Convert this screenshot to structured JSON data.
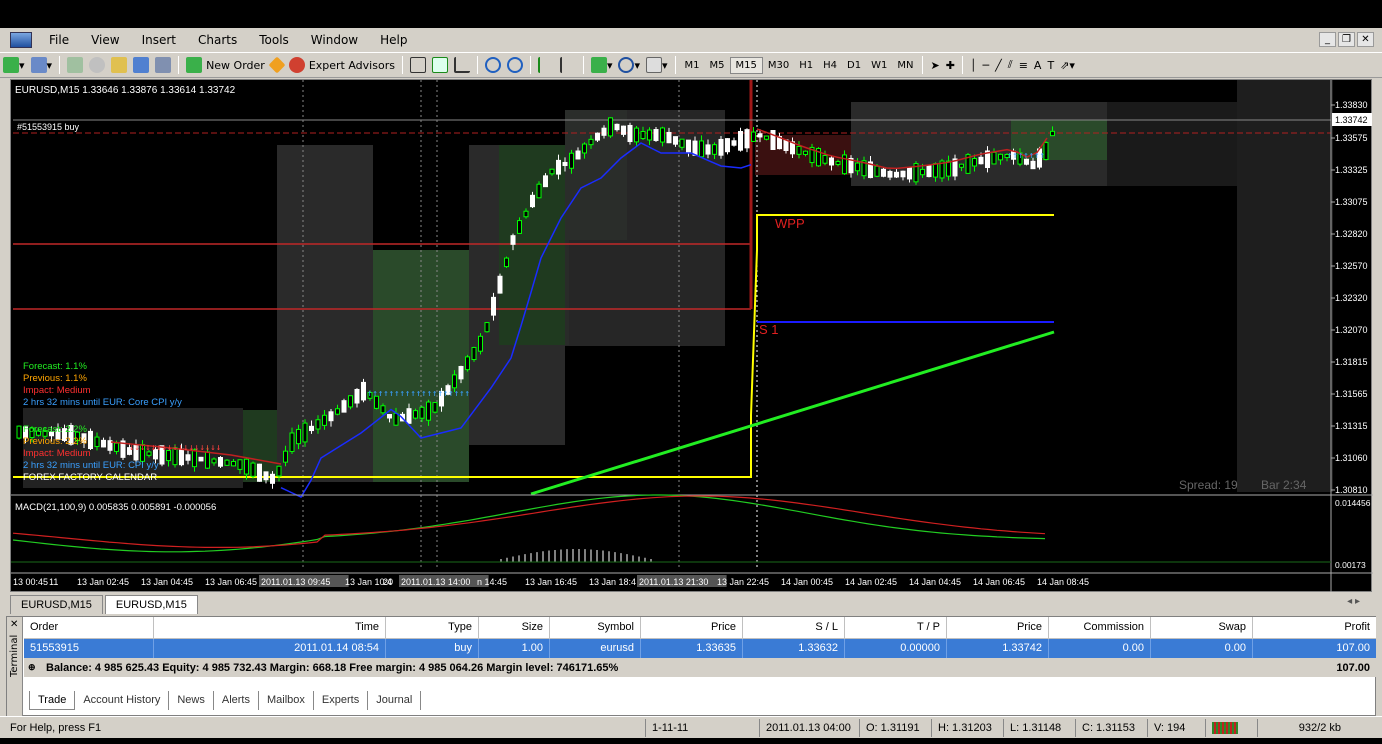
{
  "menu": {
    "items": [
      "File",
      "View",
      "Insert",
      "Charts",
      "Tools",
      "Window",
      "Help"
    ]
  },
  "toolbar": {
    "new_order": "New Order",
    "expert_advisors": "Expert Advisors",
    "timeframes": [
      "M1",
      "M5",
      "M15",
      "M30",
      "H1",
      "H4",
      "D1",
      "W1",
      "MN"
    ],
    "active_timeframe": "M15"
  },
  "chart": {
    "header": "EURUSD,M15  1.33646 1.33876 1.33614 1.33742",
    "order_line": "#51553915 buy",
    "wpp": "WPP",
    "s1": "S 1",
    "news1": {
      "forecast": "Forecast: 1.1%",
      "previous": "Previous: 1.1%",
      "impact": "Impact: Medium",
      "until": "2 hrs 32 mins until EUR: Core CPI y/y"
    },
    "news2": {
      "forecast": "Forecast: 2.2%",
      "previous": "Previous: 2.2%",
      "impact": "Impact: Medium",
      "until": "2 hrs 32 mins until EUR: CPI y/y",
      "calendar": "FOREX FACTORY CALENDAR"
    },
    "spread": "Spread: 19",
    "bar": "Bar  2:34",
    "macd_label": "MACD(21,100,9) 0.005835 0.005891 -0.000056",
    "price_labels": [
      "1.33830",
      "1.33742",
      "1.33575",
      "1.33325",
      "1.33075",
      "1.32820",
      "1.32570",
      "1.32320",
      "1.32070",
      "1.31815",
      "1.31565",
      "1.31315",
      "1.31060",
      "1.30810"
    ],
    "current_price": "1.33742",
    "macd_scale": [
      "0.014456",
      "0.00173"
    ],
    "time_labels": [
      "13 00:45",
      "11",
      "13 Jan 02:45",
      "13 Jan 04:45",
      "13 Jan 06:45",
      "2011.01.13 09:45",
      "13 Jan 10:4",
      "20",
      "2011.01.13 14:00",
      "n 14:45",
      "13 Jan 16:45",
      "13 Jan 18:4",
      "2011.01.13 21:30",
      "13 Jan 22:45",
      "14 Jan 00:45",
      "14 Jan 02:45",
      "14 Jan 04:45",
      "14 Jan 06:45",
      "14 Jan 08:45"
    ],
    "colors": {
      "bull": "#00ff00",
      "bear": "#ffffff",
      "ma": "#1a2cff",
      "wpp": "#ffff00",
      "s1": "#1a1aff",
      "trend": "#22ee22",
      "red": "#cc2222"
    }
  },
  "chart_tabs": [
    "EURUSD,M15",
    "EURUSD,M15"
  ],
  "terminal": {
    "side_label": "Terminal",
    "columns": [
      "Order",
      "Time",
      "Type",
      "Size",
      "Symbol",
      "Price",
      "S / L",
      "T / P",
      "Price",
      "Commission",
      "Swap",
      "Profit"
    ],
    "row": [
      "51553915",
      "2011.01.14 08:54",
      "buy",
      "1.00",
      "eurusd",
      "1.33635",
      "1.33632",
      "0.00000",
      "1.33742",
      "0.00",
      "0.00",
      "107.00"
    ],
    "balance_line": "Balance: 4 985 625.43  Equity: 4 985 732.43  Margin: 668.18  Free margin: 4 985 064.26  Margin level: 746171.65%",
    "balance_profit": "107.00",
    "tabs": [
      "Trade",
      "Account History",
      "News",
      "Alerts",
      "Mailbox",
      "Experts",
      "Journal"
    ]
  },
  "status": {
    "help": "For Help, press F1",
    "profile": "1-11-11",
    "datetime": "2011.01.13 04:00",
    "open": "O: 1.31191",
    "high": "H: 1.31203",
    "low": "L: 1.31148",
    "close": "C: 1.31153",
    "volume": "V: 194",
    "traffic": "932/2 kb"
  }
}
